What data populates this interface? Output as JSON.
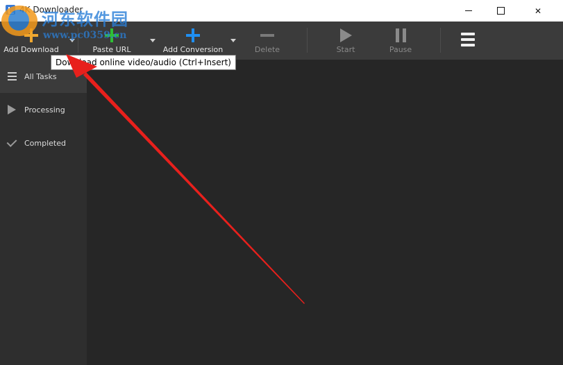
{
  "window": {
    "title": "4K Downloader"
  },
  "toolbar": {
    "buttons": [
      {
        "label": "Add Download",
        "icon": "add-icon",
        "color": "#f0a830",
        "enabled": true
      },
      {
        "label": "Paste URL",
        "icon": "paste-plus-icon",
        "color": "#2fbf35",
        "enabled": true
      },
      {
        "label": "Add Conversion",
        "icon": "add-conversion-icon",
        "color": "#1f8ff2",
        "enabled": true
      },
      {
        "label": "Delete",
        "icon": "minus-icon",
        "enabled": false
      },
      {
        "label": "Start",
        "icon": "play-icon",
        "enabled": false
      },
      {
        "label": "Pause",
        "icon": "pause-icon",
        "enabled": false
      }
    ],
    "menu_icon": "hamburger-icon"
  },
  "tooltip": {
    "text": "Download online video/audio (Ctrl+Insert)"
  },
  "sidebar": {
    "items": [
      {
        "label": "All Tasks",
        "icon": "list-icon",
        "active": true
      },
      {
        "label": "Processing",
        "icon": "play-icon",
        "active": false
      },
      {
        "label": "Completed",
        "icon": "check-icon",
        "active": false
      }
    ]
  },
  "watermark": {
    "line1": "河东软件园",
    "line2": "www.pc0359.cn"
  },
  "annotation": {
    "arrow_color": "#e8201c"
  }
}
